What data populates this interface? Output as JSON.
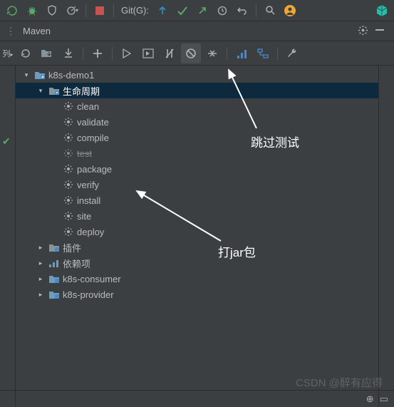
{
  "topToolbar": {
    "gitLabel": "Git(G):"
  },
  "panel": {
    "title": "Maven",
    "leftSideLabel": "列"
  },
  "tree": {
    "root": {
      "label": "k8s-demo1"
    },
    "lifecycle": {
      "label": "生命周期"
    },
    "goals": {
      "clean": "clean",
      "validate": "validate",
      "compile": "compile",
      "test": "test",
      "package": "package",
      "verify": "verify",
      "install": "install",
      "site": "site",
      "deploy": "deploy"
    },
    "plugins": {
      "label": "插件"
    },
    "dependencies": {
      "label": "依赖项"
    },
    "consumer": {
      "label": "k8s-consumer"
    },
    "provider": {
      "label": "k8s-provider"
    }
  },
  "annotations": {
    "skipTests": "跳过测试",
    "packageJar": "打jar包"
  },
  "watermark": "CSDN @醉有应得"
}
